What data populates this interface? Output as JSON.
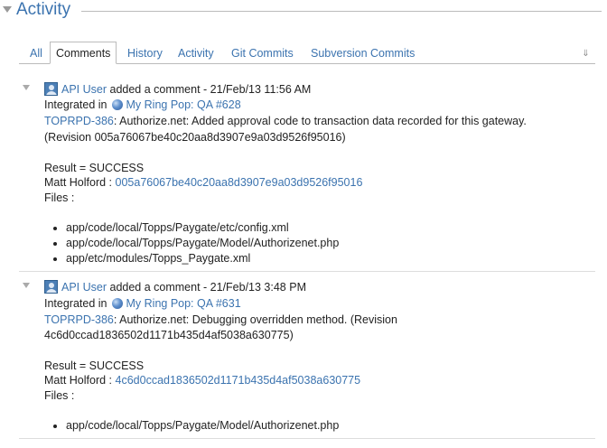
{
  "section": {
    "title": "Activity"
  },
  "tabs": [
    {
      "label": "All"
    },
    {
      "label": "Comments"
    },
    {
      "label": "History"
    },
    {
      "label": "Activity"
    },
    {
      "label": "Git Commits"
    },
    {
      "label": "Subversion Commits"
    }
  ],
  "comments": [
    {
      "user": "API User",
      "action": "added a comment - 21/Feb/13 11:56 AM",
      "integrated_label": "Integrated in",
      "build": "My Ring Pop: QA #628",
      "issue": "TOPRPD-386",
      "message": ": Authorize.net: Added approval code to transaction data recorded for this gateway.",
      "revision_line": "(Revision 005a76067be40c20aa8d3907e9a03d9526f95016)",
      "result": "Result = SUCCESS",
      "author": "Matt Holford :",
      "commit": "005a76067be40c20aa8d3907e9a03d9526f95016",
      "files_label": "Files :",
      "files": [
        "app/code/local/Topps/Paygate/etc/config.xml",
        "app/code/local/Topps/Paygate/Model/Authorizenet.php",
        "app/etc/modules/Topps_Paygate.xml"
      ]
    },
    {
      "user": "API User",
      "action": "added a comment - 21/Feb/13 3:48 PM",
      "integrated_label": "Integrated in",
      "build": "My Ring Pop: QA #631",
      "issue": "TOPRPD-386",
      "message": ": Authorize.net: Debugging overridden method. (Revision",
      "revision_line": "4c6d0ccad1836502d1171b435d4af5038a630775)",
      "result": "Result = SUCCESS",
      "author": "Matt Holford :",
      "commit": "4c6d0ccad1836502d1171b435d4af5038a630775",
      "files_label": "Files :",
      "files": [
        "app/code/local/Topps/Paygate/Model/Authorizenet.php"
      ]
    }
  ]
}
